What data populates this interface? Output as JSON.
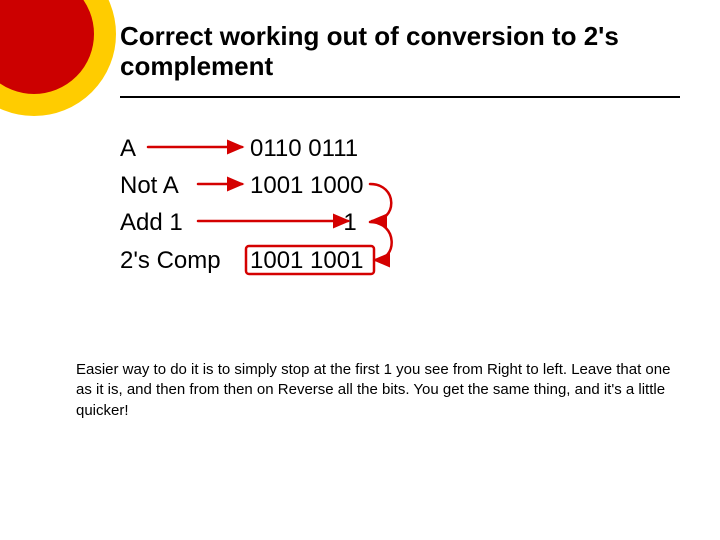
{
  "title": "Correct working out of conversion to 2's complement",
  "rows": [
    {
      "label": "A",
      "value": "0110 0111"
    },
    {
      "label": "Not A",
      "value": "1001 1000"
    },
    {
      "label": "Add 1",
      "value": "              1"
    },
    {
      "label": "2's Comp",
      "value": "1001 1001"
    }
  ],
  "footnote": "Easier way to do it is to simply stop at the first 1 you see from Right to left. Leave that one as it is, and then from then on Reverse all the bits. You get the same thing, and it's a little quicker!"
}
